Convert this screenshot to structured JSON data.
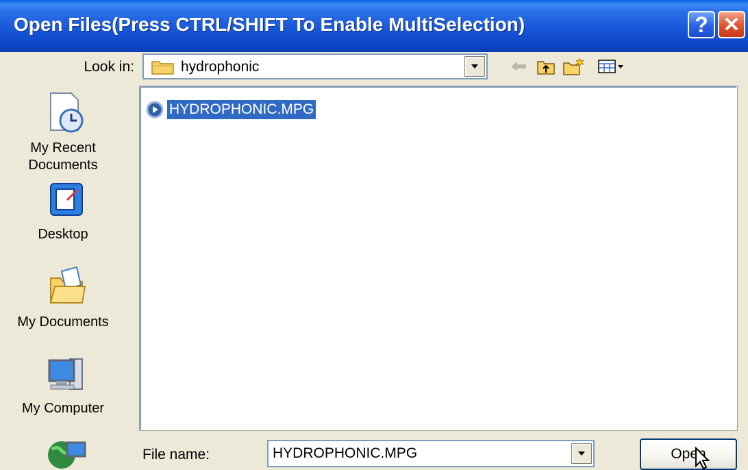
{
  "window": {
    "title": "Open Files(Press CTRL/SHIFT To Enable MultiSelection)",
    "help_button": "?",
    "close_button": "✕"
  },
  "lookin": {
    "label": "Look in:",
    "value": "hydrophonic"
  },
  "toolbar": {
    "icons": [
      "back-icon",
      "up-folder-icon",
      "new-folder-icon",
      "view-menu-icon"
    ]
  },
  "places": [
    {
      "label_line1": "My Recent",
      "label_line2": "Documents",
      "icon": "recent-documents-icon"
    },
    {
      "label_line1": "Desktop",
      "label_line2": "",
      "icon": "desktop-icon"
    },
    {
      "label_line1": "My Documents",
      "label_line2": "",
      "icon": "my-documents-icon"
    },
    {
      "label_line1": "My Computer",
      "label_line2": "",
      "icon": "my-computer-icon"
    },
    {
      "label_line1": "",
      "label_line2": "",
      "icon": "my-network-places-icon"
    }
  ],
  "files": [
    {
      "name": "HYDROPHONIC.MPG",
      "selected": true,
      "icon": "video-file-icon"
    }
  ],
  "filename": {
    "label": "File name:",
    "value": "HYDROPHONIC.MPG"
  },
  "buttons": {
    "open": "Open"
  },
  "colors": {
    "titlebar": "#0a4fd6",
    "selection": "#316ac5",
    "dialog_bg": "#ece9d8"
  }
}
